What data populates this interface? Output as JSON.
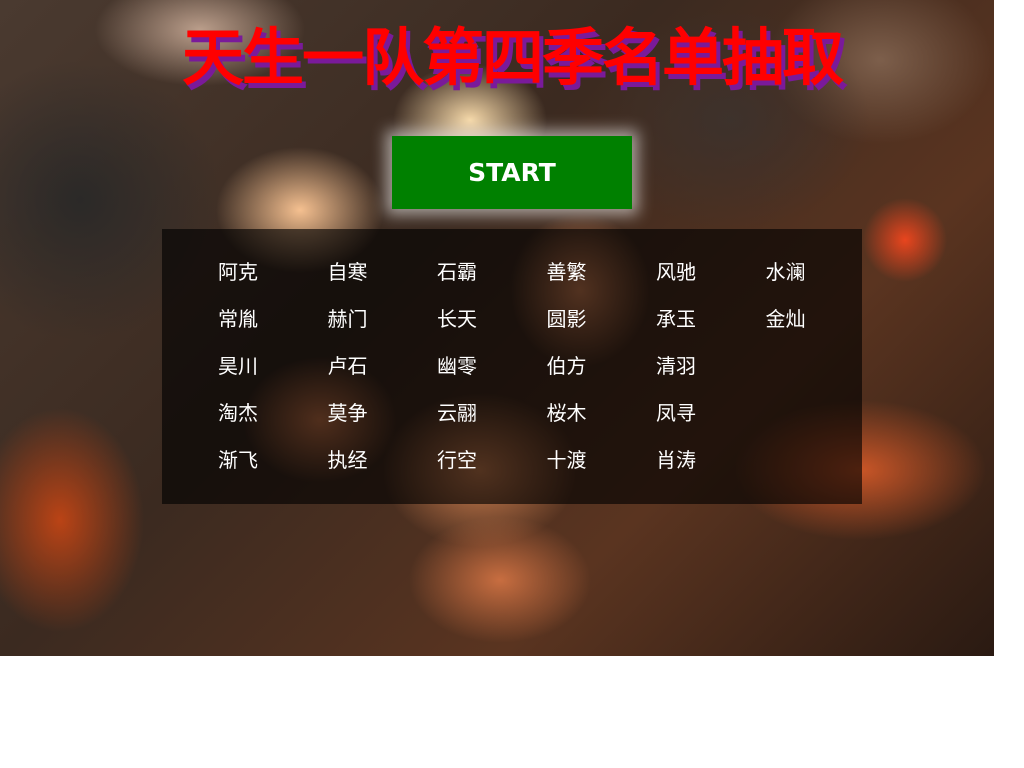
{
  "page": {
    "title": "天生一队第四季名单抽取",
    "start_label": "START"
  },
  "names": {
    "rows": [
      [
        "阿克",
        "自寒",
        "石霸",
        "善繁",
        "风驰",
        "水澜"
      ],
      [
        "常胤",
        "赫门",
        "长天",
        "圆影",
        "承玉",
        "金灿"
      ],
      [
        "昊川",
        "卢石",
        "幽零",
        "伯方",
        "清羽"
      ],
      [
        "淘杰",
        "莫争",
        "云翮",
        "桜木",
        "凤寻"
      ],
      [
        "渐飞",
        "执经",
        "行空",
        "十渡",
        "肖涛"
      ]
    ]
  },
  "colors": {
    "title": "#ff0000",
    "title_shadow": "#7a1a9a",
    "start_button": "#008000",
    "name_text": "#ffffff"
  }
}
